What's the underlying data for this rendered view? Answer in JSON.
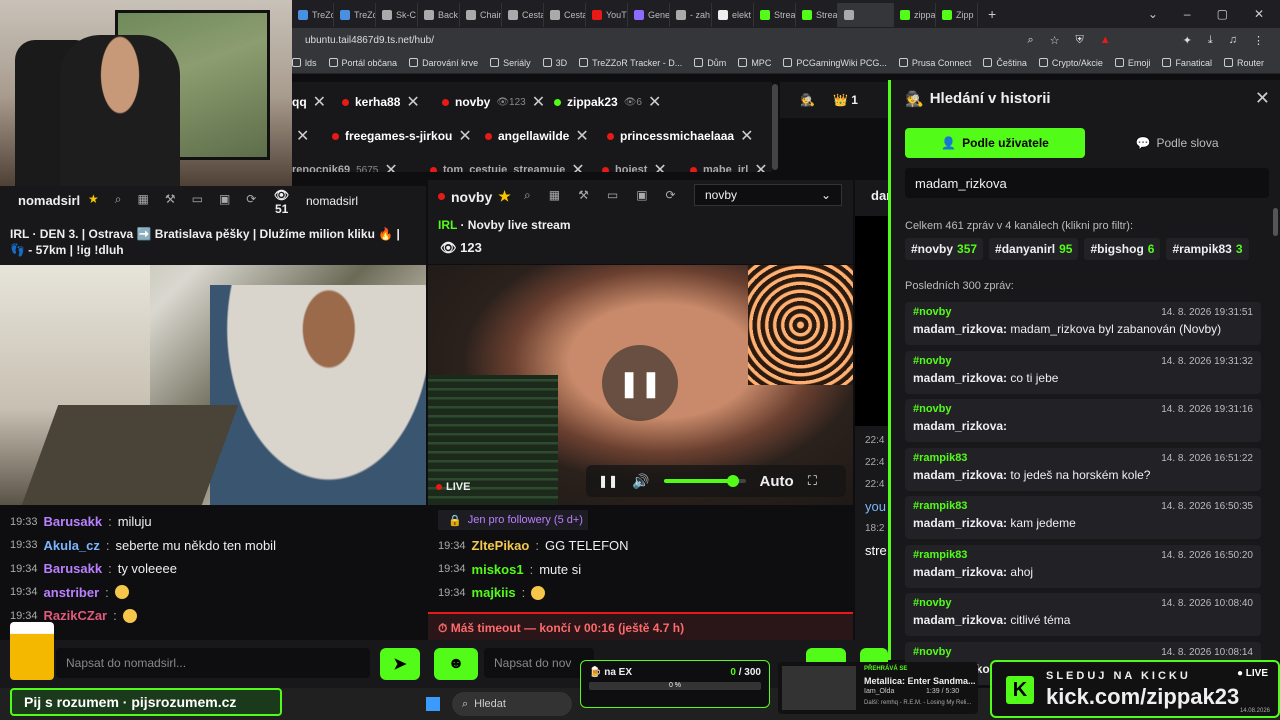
{
  "browser": {
    "tabs": [
      "TreZo",
      "TreZo",
      "Sk-C",
      "Back",
      "Chain",
      "Cesta",
      "Cesta",
      "YouT",
      "Gene",
      "- zah",
      "elekt",
      "Strea",
      "Strea",
      "",
      "zippa",
      "Zipp"
    ],
    "url": "ubuntu.tail4867d9.ts.net/hub/",
    "bookmarks": [
      "lds",
      "Portál občana",
      "Darování krve",
      "Seriály",
      "3D",
      "TreZZoR Tracker - D...",
      "Dům",
      "MPC",
      "PCGamingWiki PCG...",
      "Prusa Connect",
      "Čeština",
      "Crypto/Akcie",
      "Emoji",
      "Fanatical",
      "Router"
    ]
  },
  "channel_tabs": {
    "row1": [
      {
        "name": "qq",
        "count": ""
      },
      {
        "name": "kerha88",
        "count": ""
      },
      {
        "name": "novby",
        "count": "123"
      },
      {
        "name": "zippak23",
        "count": "6"
      }
    ],
    "row2": [
      {
        "name": "freegames-s-jirkou"
      },
      {
        "name": "angellawilde"
      },
      {
        "name": "princessmichaelaaa"
      }
    ],
    "row3": [
      {
        "name": "renocnik69",
        "count": "5675"
      },
      {
        "name": "tom_cestuje_streamuje"
      },
      {
        "name": "hoiest"
      },
      {
        "name": "mabe_irl"
      }
    ],
    "viewers_count": "1"
  },
  "left": {
    "channel": "nomadsirl",
    "viewers": "51",
    "search_value": "nomadsirl",
    "title": "IRL · DEN 3. | Ostrava ➡️ Bratislava pěšky | Dlužíme milion kliku 🔥 | 👣 - 57km | !ig !dluh",
    "chat": [
      {
        "time": "19:33",
        "user": "Barusakk",
        "color": "#b980ff",
        "text": "miluju"
      },
      {
        "time": "19:33",
        "user": "Akula_cz",
        "color": "#7cb5ff",
        "text": "seberte mu někdo ten mobil"
      },
      {
        "time": "19:34",
        "user": "Barusakk",
        "color": "#b980ff",
        "text": "ty voleeee"
      },
      {
        "time": "19:34",
        "user": "anstriber",
        "color": "#b980ff",
        "text": ""
      },
      {
        "time": "19:34",
        "user": "RazikCZar",
        "color": "#e05a7a",
        "text": ""
      }
    ],
    "input_placeholder": "Napsat do nomadsirl..."
  },
  "middle": {
    "channel": "novby",
    "category": "IRL",
    "title": "Novby live stream",
    "viewers": "123",
    "select_value": "novby",
    "player": {
      "live": "LIVE",
      "quality": "Auto",
      "volume": 0.85
    },
    "followers_notice": "Jen pro followery (5 d+)",
    "chat": [
      {
        "time": "19:34",
        "user": "ZltePikao",
        "color": "#f2c94c",
        "text": "GG TELEFON"
      },
      {
        "time": "19:34",
        "user": "miskos1",
        "color": "#53fc18",
        "text": "mute si"
      },
      {
        "time": "19:34",
        "user": "majkiis",
        "color": "#53fc18",
        "text": ""
      }
    ],
    "timeout": "⏱ Máš timeout — končí v 00:16 (ještě 4.7 h)",
    "input_placeholder": "Napsat do nov"
  },
  "partial_column": {
    "channel": "dar",
    "times": [
      "22:4",
      "22:4",
      "22:4",
      "18:2",
      "18:2"
    ],
    "texts": [
      "you",
      "stre"
    ]
  },
  "history": {
    "title": "Hledání v historii",
    "tab_user": "Podle uživatele",
    "tab_word": "Podle slova",
    "search_value": "madam_rizkova",
    "summary": "Celkem 461 zpráv v 4 kanálech (klikni pro filtr):",
    "filters": [
      {
        "name": "#novby",
        "count": "357"
      },
      {
        "name": "#danyanirl",
        "count": "95"
      },
      {
        "name": "#bigshog",
        "count": "6"
      },
      {
        "name": "#rampik83",
        "count": "3"
      }
    ],
    "recent_label": "Posledních 300 zpráv:",
    "messages": [
      {
        "channel": "#novby",
        "date": "14. 8. 2026 19:31:51",
        "user": "madam_rizkova:",
        "text": "madam_rizkova byl zabanován (Novby)"
      },
      {
        "channel": "#novby",
        "date": "14. 8. 2026 19:31:32",
        "user": "madam_rizkova:",
        "text": "co ti jebe"
      },
      {
        "channel": "#novby",
        "date": "14. 8. 2026 19:31:16",
        "user": "madam_rizkova:",
        "text": ""
      },
      {
        "channel": "#rampik83",
        "date": "14. 8. 2026 16:51:22",
        "user": "madam_rizkova:",
        "text": "to jedeš na horském kole?"
      },
      {
        "channel": "#rampik83",
        "date": "14. 8. 2026 16:50:35",
        "user": "madam_rizkova:",
        "text": "kam jedeme"
      },
      {
        "channel": "#rampik83",
        "date": "14. 8. 2026 16:50:20",
        "user": "madam_rizkova:",
        "text": "ahoj"
      },
      {
        "channel": "#novby",
        "date": "14. 8. 2026 10:08:40",
        "user": "madam_rizkova:",
        "text": "citlivé téma"
      },
      {
        "channel": "#novby",
        "date": "14. 8. 2026 10:08:14",
        "user": "madam_rizkova:",
        "text": ""
      }
    ]
  },
  "overlays": {
    "beer_text": "Pij s rozumem · pijsrozumem.cz",
    "ex_label": "na EX",
    "ex_value": "0",
    "ex_max": "/ 300",
    "ex_percent": "0 %",
    "np_label": "PŘEHRÁVÁ SE",
    "np_song": "Metallica: Enter Sandma...",
    "np_user": "Iam_Olda",
    "np_time": "1:39 / 5:30",
    "np_next": "Další: remhq - R.E.M. - Losing My Reli...",
    "kick_title": "SLEDUJ NA KICKU",
    "kick_live": "LIVE",
    "kick_url": "kick.com/zippak23",
    "kick_date": "14.08.2026"
  },
  "taskbar": {
    "search": "Hledat"
  },
  "colors": {
    "accent": "#53fc18",
    "live": "#e91916",
    "panel": "#18181b",
    "bg": "#0e0e10"
  }
}
